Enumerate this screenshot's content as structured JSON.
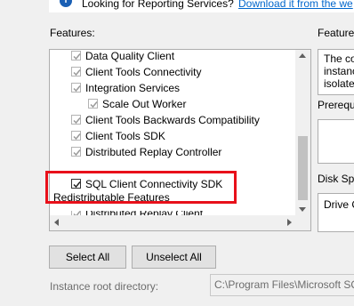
{
  "info": {
    "icon": "info-icon",
    "text": "Looking for Reporting Services?",
    "link": "Download it from the we"
  },
  "features": {
    "label": "Features:",
    "items": [
      {
        "label": "Data Quality Client",
        "checked": true
      },
      {
        "label": "Client Tools Connectivity",
        "checked": true
      },
      {
        "label": "Integration Services",
        "checked": true
      },
      {
        "label": "Scale Out Worker",
        "checked": true
      },
      {
        "label": "Client Tools Backwards Compatibility",
        "checked": true
      },
      {
        "label": "Client Tools SDK",
        "checked": true
      },
      {
        "label": "Distributed Replay Controller",
        "checked": true
      },
      {
        "label": "Distributed Replay Client",
        "checked": true
      },
      {
        "label": "SQL Client Connectivity SDK",
        "checked": true
      }
    ],
    "redistributable": "Redistributable Features"
  },
  "right_panel": {
    "feature_desc_label": "Feature",
    "desc_lines": [
      "The co",
      "instanc",
      "isolate"
    ],
    "prereq_label": "Prerequ",
    "disk_label": "Disk Spa",
    "drive_text": "Drive C"
  },
  "buttons": {
    "select_all": "Select All",
    "unselect_all": "Unselect All"
  },
  "instance_root": {
    "label": "Instance root directory:",
    "value": "C:\\Program Files\\Microsoft SQ"
  },
  "colors": {
    "highlight": "#e8101a",
    "link": "#0066cc",
    "info_icon": "#1a5fb4"
  }
}
